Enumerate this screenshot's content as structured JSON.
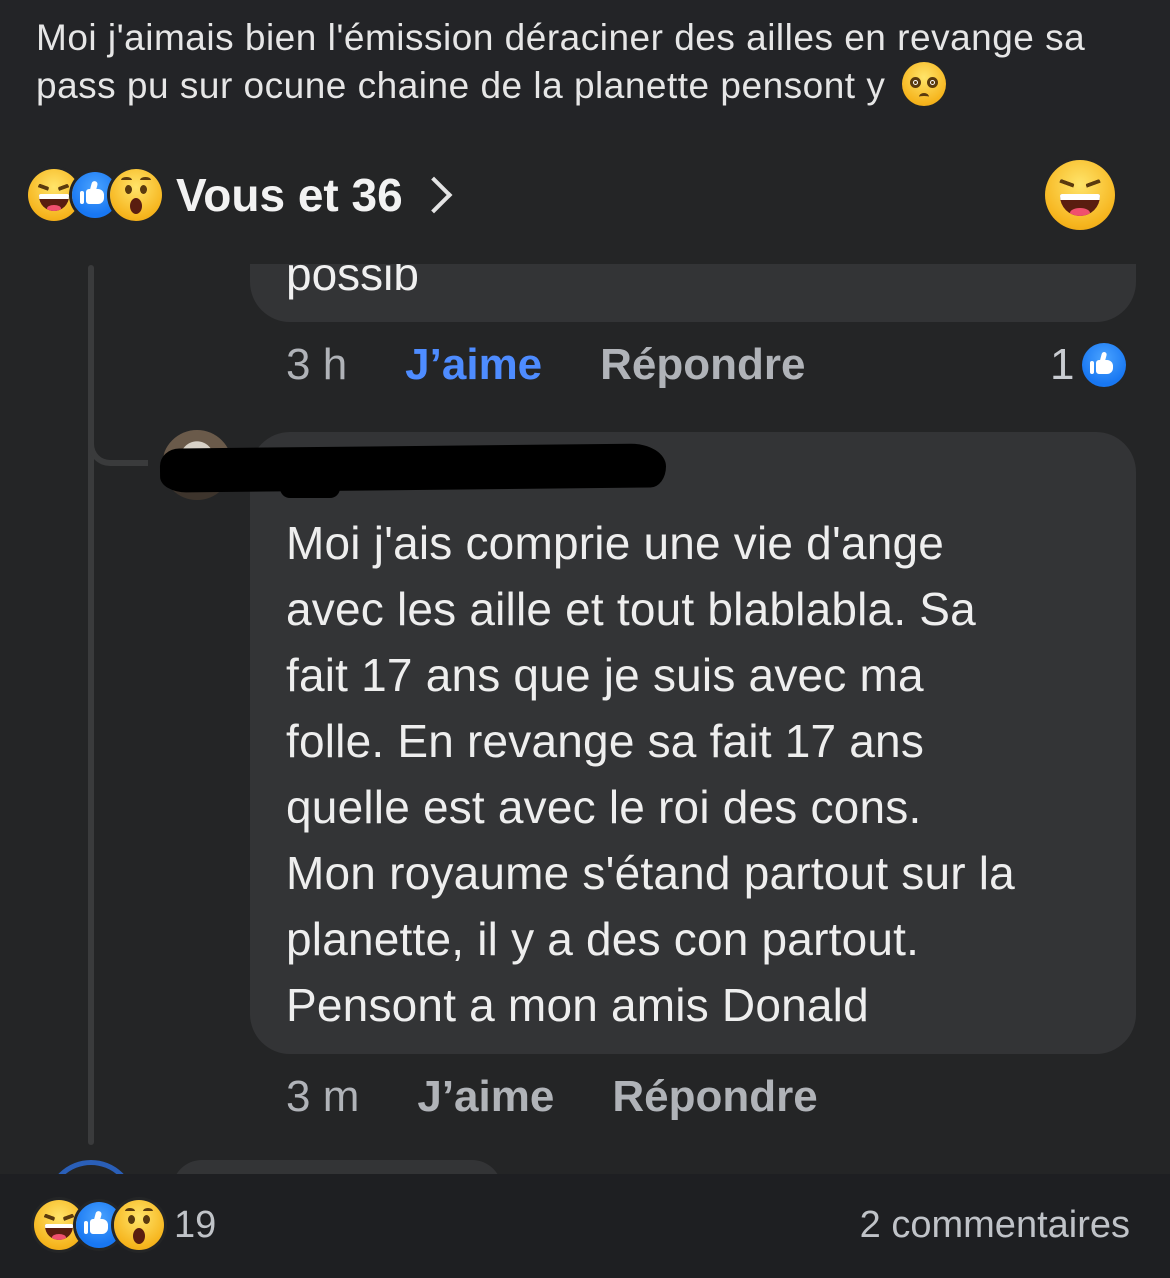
{
  "post": {
    "caption": "Moi j'aimais bien l'émission déraciner des ailles en revange sa pass pu sur ocune chaine de la planette pensont y",
    "caption_emoji": "pleading-face-icon"
  },
  "reactions_header": {
    "label": "Vous et 36",
    "icons": [
      "laughing-face-icon",
      "like-thumb-icon",
      "astonished-face-icon"
    ],
    "selected_reaction": "laughing-face-icon"
  },
  "comments": [
    {
      "text_fragment": "possib",
      "time": "3 h",
      "like_label": "J’aime",
      "like_active": true,
      "reply_label": "Répondre",
      "like_count": "1"
    },
    {
      "author": "",
      "lines": [
        "Moi j'ais comprie une vie d'ange",
        "avec les aille et tout blablabla. Sa",
        "fait 17 ans que je suis avec ma",
        "folle. En revange sa fait 17 ans",
        "quelle est avec le roi des cons.",
        "Mon royaume s'étand partout sur la",
        "planette, il y a des con partout.",
        "Pensont a mon amis Donald"
      ],
      "time": "3 m",
      "like_label": "J’aime",
      "like_active": false,
      "reply_label": "Répondre"
    }
  ],
  "footer": {
    "reaction_count": "19",
    "comments_label": "2 commentaires"
  },
  "colors": {
    "background": "#242526",
    "bubble": "#333436",
    "accent_blue": "#4e8cff",
    "muted_text": "#b0b3b8"
  }
}
